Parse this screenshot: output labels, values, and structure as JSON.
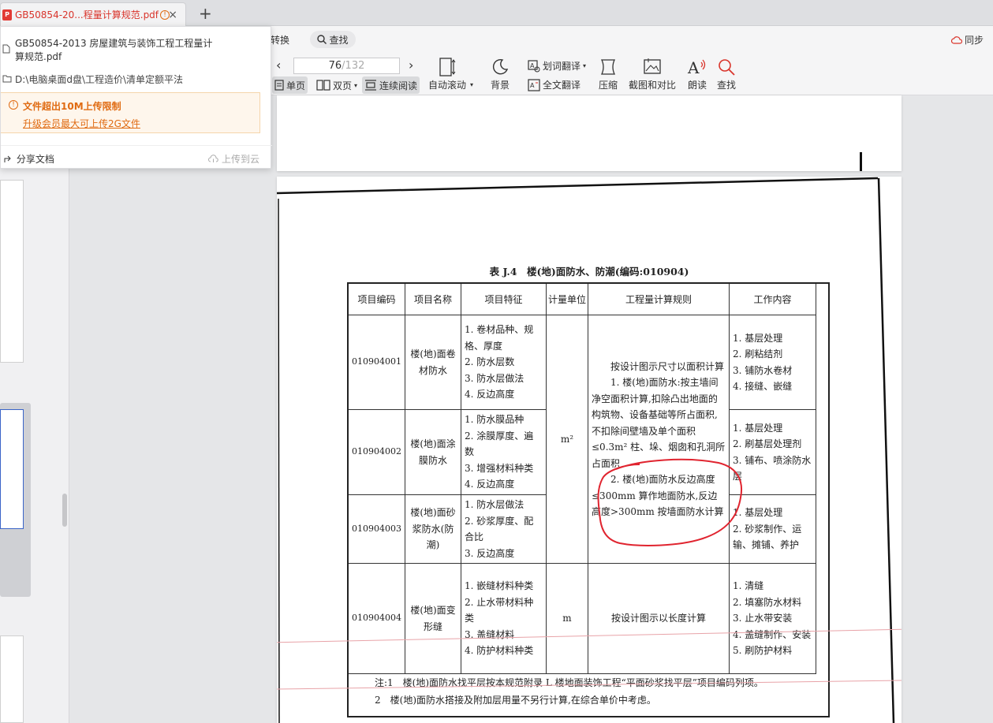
{
  "tab": {
    "title": "GB50854-20...程量计算规范.pdf",
    "close": "×",
    "new": "+"
  },
  "toolbar": {
    "convert_label": "转换",
    "search_pill_label": "查找",
    "page_current": "76",
    "page_total": "/132",
    "single_page": "单页",
    "double_page": "双页",
    "continuous_read": "连续阅读",
    "auto_scroll": "自动滚动",
    "background": "背景",
    "word_translate": "划词翻译",
    "full_translate": "全文翻译",
    "compress": "压缩",
    "screenshot_compare": "截图和对比",
    "read_aloud": "朗读",
    "find": "查找",
    "sync_label": "同步"
  },
  "popup": {
    "filename": "GB50854-2013 房屋建筑与装饰工程工程量计算规范.pdf",
    "path": "D:\\电脑桌面d盘\\工程造价\\清单定额平法",
    "warning_title": "文件超出10M上传限制",
    "warning_link": "升级会员最大可上传2G文件",
    "share": "分享文档",
    "upload": "上传到云"
  },
  "document": {
    "caption": "表 J.4　楼(地)面防水、防潮(编码:010904)",
    "headers": [
      "项目编码",
      "项目名称",
      "项目特征",
      "计量单位",
      "工程量计算规则",
      "工作内容"
    ],
    "rows": [
      {
        "code": "010904001",
        "name": "楼(地)面卷材防水",
        "features": [
          "1. 卷材品种、规格、厚度",
          "2. 防水层数",
          "3. 防水层做法",
          "4. 反边高度"
        ],
        "work": [
          "1. 基层处理",
          "2. 刷粘结剂",
          "3. 铺防水卷材",
          "4. 接缝、嵌缝"
        ]
      },
      {
        "code": "010904002",
        "name": "楼(地)面涂膜防水",
        "features": [
          "1. 防水膜品种",
          "2. 涂膜厚度、遍数",
          "3. 增强材料种类",
          "4. 反边高度"
        ],
        "work": [
          "1. 基层处理",
          "2. 刷基层处理剂",
          "3. 铺布、喷涂防水层"
        ]
      },
      {
        "code": "010904003",
        "name": "楼(地)面砂浆防水(防潮)",
        "features": [
          "1. 防水层做法",
          "2. 砂浆厚度、配合比",
          "3. 反边高度"
        ],
        "work": [
          "1. 基层处理",
          "2. 砂浆制作、运输、摊铺、养护"
        ]
      },
      {
        "code": "010904004",
        "name": "楼(地)面变形缝",
        "features": [
          "1. 嵌缝材料种类",
          "2. 止水带材料种类",
          "3. 盖缝材料",
          "4. 防护材料种类"
        ],
        "unit": "m",
        "rule": "按设计图示以长度计算",
        "work": [
          "1. 清缝",
          "2. 填塞防水材料",
          "3. 止水带安装",
          "4. 盖缝制作、安装",
          "5. 刷防护材料"
        ]
      }
    ],
    "shared_unit": "m²",
    "shared_rule": [
      "按设计图示尺寸以面积计算",
      "1. 楼(地)面防水:按主墙间净空面积计算,扣除凸出地面的构筑物、设备基础等所占面积,不扣除间壁墙及单个面积≤0.3m² 柱、垛、烟囱和孔洞所占面积",
      "2. 楼(地)面防水反边高度≤300mm 算作地面防水,反边高度>300mm 按墙面防水计算"
    ],
    "notes": [
      "注:1　楼(地)面防水找平层按本规范附录 L 楼地面装饰工程“平面砂浆找平层”项目编码列项。",
      "2　楼(地)面防水搭接及附加层用量不另行计算,在综合单价中考虑。"
    ]
  },
  "colors": {
    "accent_red": "#d9342b",
    "warning_orange": "#e06b12",
    "annotation_red": "#e0242f"
  }
}
